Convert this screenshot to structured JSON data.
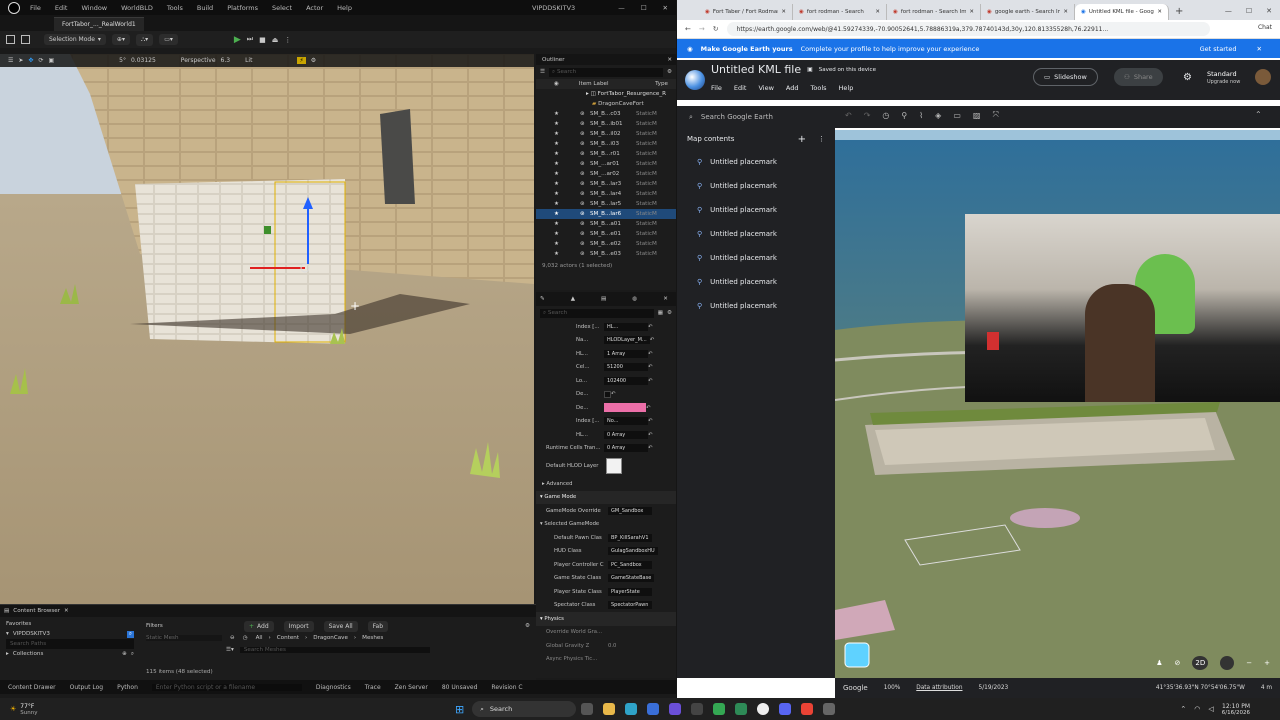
{
  "ue": {
    "menu": [
      "File",
      "Edit",
      "Window",
      "WorldBLD",
      "Tools",
      "Build",
      "Platforms",
      "Select",
      "Actor",
      "Help"
    ],
    "project_name": "VIPDDSKITV3",
    "level_tab": "FortTabor_..._RealWorld1",
    "selection_mode": "Selection Mode",
    "viewport": {
      "perspective": "Perspective",
      "lit": "Lit",
      "angle": "5°",
      "scale": "0.03125",
      "cam_speed": "6.3"
    },
    "outliner": {
      "title": "Outliner",
      "search_placeholder": "Search",
      "col_label": "Item Label",
      "col_type": "Type",
      "root": "FortTabor_Resurgence_R",
      "folder": "DragonCaveFort",
      "items": [
        {
          "label": "SM_B...c03",
          "type": "StaticM"
        },
        {
          "label": "SM_B...ib01",
          "type": "StaticM"
        },
        {
          "label": "SM_B...il02",
          "type": "StaticM"
        },
        {
          "label": "SM_B...i03",
          "type": "StaticM"
        },
        {
          "label": "SM_B...r01",
          "type": "StaticM"
        },
        {
          "label": "SM_...ar01",
          "type": "StaticM"
        },
        {
          "label": "SM_...ar02",
          "type": "StaticM"
        },
        {
          "label": "SM_B...lar3",
          "type": "StaticM"
        },
        {
          "label": "SM_B...lar4",
          "type": "StaticM"
        },
        {
          "label": "SM_B...lar5",
          "type": "StaticM"
        },
        {
          "label": "SM_B...lar6",
          "type": "StaticM"
        },
        {
          "label": "SM_B...a01",
          "type": "StaticM"
        },
        {
          "label": "SM_B...e01",
          "type": "StaticM"
        },
        {
          "label": "SM_B...e02",
          "type": "StaticM"
        },
        {
          "label": "SM_B...e03",
          "type": "StaticM"
        }
      ],
      "footer": "9,032 actors (1 selected)"
    },
    "details": {
      "search_placeholder": "Search",
      "rows": [
        {
          "label": "Index [...",
          "value": "HL..."
        },
        {
          "label": "Na...",
          "value": "HLODLayer_M..."
        },
        {
          "label": "HL...",
          "value": "1 Array"
        },
        {
          "label": "Cel...",
          "value": "51200"
        },
        {
          "label": "Lo...",
          "value": "102400"
        },
        {
          "label": "De...",
          "value": ""
        },
        {
          "label": "De...",
          "value": ""
        },
        {
          "label": "Index [...",
          "value": "No..."
        },
        {
          "label": "HL...",
          "value": "0 Array"
        },
        {
          "label": "Runtime Cells Tran...",
          "value": "0 Array"
        }
      ],
      "default_hlod_label": "Default HLOD Layer",
      "advanced": "Advanced",
      "game_mode_section": "Game Mode",
      "gamemode_override_label": "GameMode Override",
      "gamemode_override_value": "GM_Sandbox",
      "selected_gamemode": "Selected GameMode",
      "gm_rows": [
        {
          "label": "Default Pawn Clas",
          "value": "BP_KillSarahV1"
        },
        {
          "label": "HUD Class",
          "value": "GulagSandboxHU"
        },
        {
          "label": "Player Controller C",
          "value": "PC_Sandbox"
        },
        {
          "label": "Game State Class",
          "value": "GameStateBase"
        },
        {
          "label": "Player State Class",
          "value": "PlayerState"
        },
        {
          "label": "Spectator Class",
          "value": "SpectatorPawn"
        }
      ],
      "physics_section": "Physics",
      "phys_rows": [
        {
          "label": "Override World Gra...",
          "value": ""
        },
        {
          "label": "Global Gravity Z",
          "value": "0.0"
        },
        {
          "label": "Async Physics Tic...",
          "value": ""
        }
      ]
    },
    "content_browser": {
      "title": "Content Browser",
      "favorites": "Favorites",
      "project": "VIPDDSKITV3",
      "search_placeholder": "Search Paths",
      "collections": "Collections",
      "filters": "Filters",
      "static_mesh_filter": "Static Mesh",
      "add": "Add",
      "import": "Import",
      "save_all": "Save All",
      "fab": "Fab",
      "path": [
        "All",
        "Content",
        "DragonCave",
        "Meshes"
      ],
      "search_meshes": "Search Meshes",
      "count": "115 items (48 selected)"
    },
    "status": {
      "content_drawer": "Content Drawer",
      "output_log": "Output Log",
      "python": "Python",
      "python_placeholder": "Enter Python script or a filename",
      "diagnostics": "Diagnostics",
      "trace": "Trace",
      "zen": "Zen Server",
      "unsaved": "80 Unsaved",
      "revision": "Revision C"
    }
  },
  "browser": {
    "tabs": [
      {
        "label": "Fort Taber / Fort Rodman",
        "active": false
      },
      {
        "label": "fort rodman - Search",
        "active": false
      },
      {
        "label": "fort rodman - Search Ima",
        "active": false
      },
      {
        "label": "google earth - Search Im",
        "active": false
      },
      {
        "label": "Untitled KML file - Goog",
        "active": true
      }
    ],
    "url": "https://earth.google.com/web/@41.59274339,-70.90052641,5.78886319a,379.78740143d,30y,120.81335528h,76.22911...",
    "chat": "Chat"
  },
  "ge": {
    "banner_title": "Make Google Earth yours",
    "banner_text": "Complete your profile to help improve your experience",
    "get_started": "Get started",
    "file_title": "Untitled KML file",
    "saved": "Saved on this device",
    "menus": [
      "File",
      "Edit",
      "View",
      "Add",
      "Tools",
      "Help"
    ],
    "slideshow": "Slideshow",
    "share": "Share",
    "plan": "Standard",
    "upgrade": "Upgrade now",
    "search_placeholder": "Search Google Earth",
    "map_contents": "Map contents",
    "placemarks": [
      "Untitled placemark",
      "Untitled placemark",
      "Untitled placemark",
      "Untitled placemark",
      "Untitled placemark",
      "Untitled placemark",
      "Untitled placemark"
    ],
    "zoom_btn": "2D",
    "status": {
      "google": "Google",
      "zoom": "100%",
      "attribution": "Data attribution",
      "date": "5/19/2023",
      "coords": "41°35'36.93\"N 70°54'06.75\"W",
      "elev": "4 m"
    }
  },
  "taskbar": {
    "weather_temp": "77°F",
    "weather_desc": "Sunny",
    "search": "Search",
    "time": "12:10 PM",
    "date": "6/16/2026"
  }
}
